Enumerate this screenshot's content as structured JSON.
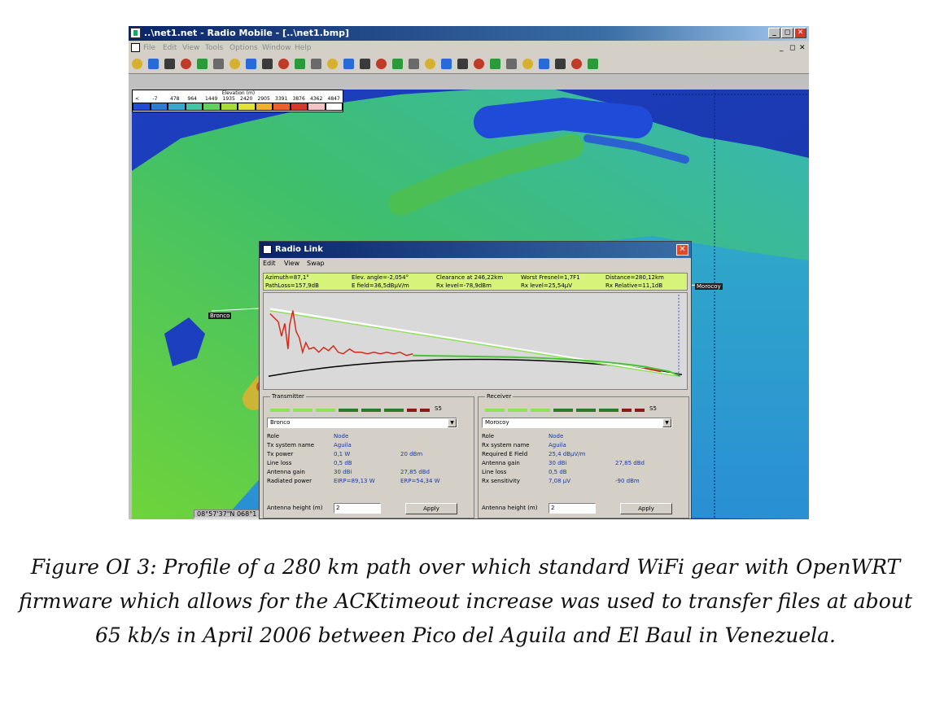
{
  "window": {
    "title": "..\\net1.net - Radio Mobile - [..\\net1.bmp]",
    "controls": [
      "_",
      "◻",
      "✕"
    ]
  },
  "menu": [
    "File",
    "Edit",
    "View",
    "Tools",
    "Options",
    "Window",
    "Help"
  ],
  "toolbar_icons": [
    "new-icon",
    "open-icon",
    "save-icon",
    "properties-icon",
    "link-icon",
    "globe-icon",
    "radio-icon",
    "zoom-icon",
    "play-icon",
    "back-icon",
    "map-icon",
    "map-edit-icon",
    "merge-icon",
    "picture-icon",
    "print-icon",
    "copy-icon",
    "paste-icon",
    "coverage-icon",
    "settings-icon",
    "select-icon",
    "network-icon",
    "grid-icon",
    "terrain-icon",
    "earth-icon",
    "sphere-icon",
    "color-icon",
    "chart-icon",
    "image-icon",
    "exit-icon"
  ],
  "legend": {
    "title": "Elevation (m)",
    "values": [
      "<",
      "-7",
      "478",
      "964",
      "1449",
      "1935",
      "2420",
      "2905",
      "3391",
      "3876",
      "4362",
      "4847"
    ],
    "colors": [
      "#1f4bd8",
      "#2a7ad8",
      "#35a9d0",
      "#3fc7a6",
      "#5fd45a",
      "#a5dc3a",
      "#e3e23a",
      "#f2b02e",
      "#e8622a",
      "#d43a2a",
      "#f4c4c4",
      "#ffffff"
    ]
  },
  "map_labels": {
    "tx": "Bronco",
    "rx": "Morocoy"
  },
  "status_coord": "08°57'37\"N 068°1",
  "dialog": {
    "title": "Radio Link",
    "menu": [
      "Edit",
      "View",
      "Swap"
    ],
    "info": {
      "azimuth": "Azimuth=87,1°",
      "elev": "Elev. angle=-2,054°",
      "clearance": "Clearance at 246,22km",
      "fresnel": "Worst Fresnel=1,7F1",
      "distance": "Distance=280,12km",
      "pathloss": "PathLoss=157,9dB",
      "efield": "E field=36,5dBµV/m",
      "rxlevel_dbm": "Rx level=-78,9dBm",
      "rxlevel_uv": "Rx level=25,54µV",
      "rxrel": "Rx Relative=11,1dB"
    },
    "transmitter": {
      "group_label": "Transmitter",
      "meter": "S5",
      "unit": "Bronco",
      "rows": [
        [
          "Role",
          "Node",
          ""
        ],
        [
          "Tx system name",
          "Aguila",
          ""
        ],
        [
          "Tx power",
          "0,1 W",
          "20 dBm"
        ],
        [
          "Line loss",
          "0,5 dB",
          ""
        ],
        [
          "Antenna gain",
          "30 dBi",
          "27,85 dBd"
        ],
        [
          "Radiated power",
          "EIRP=89,13 W",
          "ERP=54,34 W"
        ]
      ],
      "antenna_label": "Antenna height (m)",
      "antenna_value": "2",
      "apply": "Apply"
    },
    "receiver": {
      "group_label": "Receiver",
      "meter": "S5",
      "unit": "Morocoy",
      "rows": [
        [
          "Role",
          "Node",
          ""
        ],
        [
          "Rx system name",
          "Aguila",
          ""
        ],
        [
          "Required E Field",
          "25,4 dBµV/m",
          ""
        ],
        [
          "Antenna gain",
          "30 dBi",
          "27,85 dBd"
        ],
        [
          "Line loss",
          "0,5 dB",
          ""
        ],
        [
          "Rx sensitivity",
          "7,08 µV",
          "-90 dBm"
        ]
      ],
      "antenna_label": "Antenna height (m)",
      "antenna_value": "2",
      "apply": "Apply"
    }
  },
  "caption": "Figure OI 3: Profile of a 280 km path over which standard WiFi gear with OpenWRT firmware which allows for the ACKtimeout increase was used to transfer files at about 65 kb/s in April 2006 between Pico del Aguila and El Baul in Venezuela."
}
